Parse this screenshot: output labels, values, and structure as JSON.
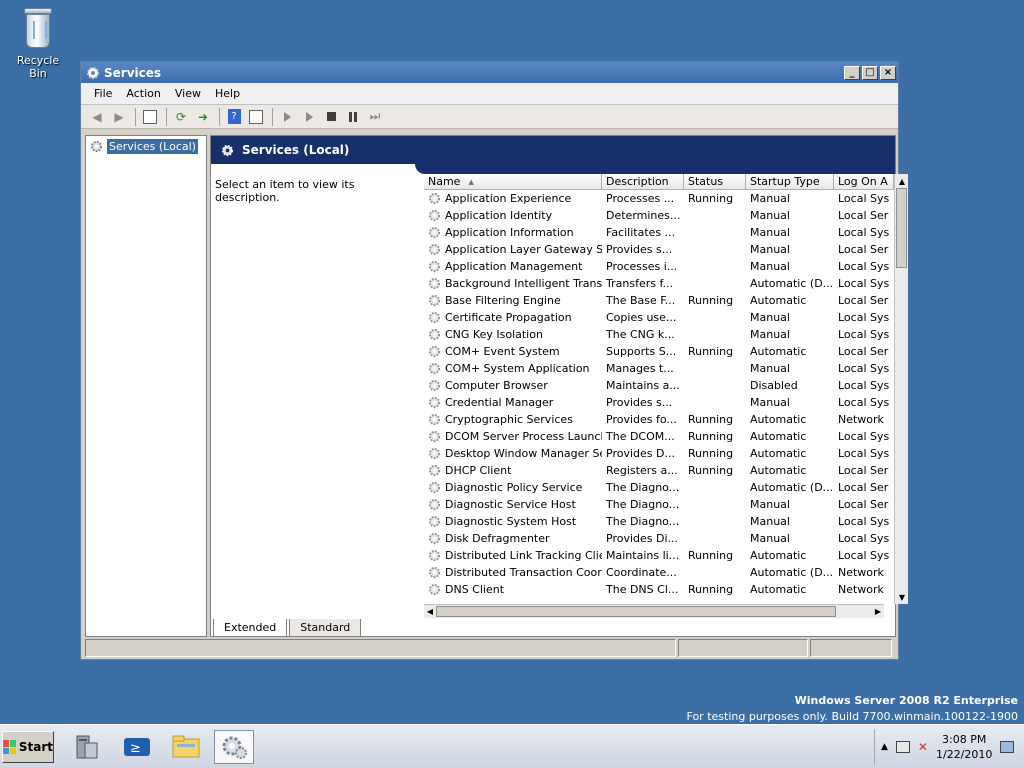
{
  "desktop": {
    "recycle_bin_label": "Recycle Bin"
  },
  "window": {
    "title": "Services",
    "controls": {
      "minimize": "_",
      "maximize": "□",
      "close": "×"
    }
  },
  "menu": [
    "File",
    "Action",
    "View",
    "Help"
  ],
  "tree": {
    "root": "Services (Local)"
  },
  "panel": {
    "header": "Services (Local)",
    "description_prompt": "Select an item to view its description."
  },
  "list": {
    "columns": [
      "Name",
      "Description",
      "Status",
      "Startup Type",
      "Log On A"
    ],
    "sort_indicator": "▲",
    "rows": [
      [
        "Application Experience",
        "Processes ...",
        "Running",
        "Manual",
        "Local Sys"
      ],
      [
        "Application Identity",
        "Determines...",
        "",
        "Manual",
        "Local Ser"
      ],
      [
        "Application Information",
        "Facilitates ...",
        "",
        "Manual",
        "Local Sys"
      ],
      [
        "Application Layer Gateway Se...",
        "Provides s...",
        "",
        "Manual",
        "Local Ser"
      ],
      [
        "Application Management",
        "Processes i...",
        "",
        "Manual",
        "Local Sys"
      ],
      [
        "Background Intelligent Transf...",
        "Transfers f...",
        "",
        "Automatic (D...",
        "Local Sys"
      ],
      [
        "Base Filtering Engine",
        "The Base F...",
        "Running",
        "Automatic",
        "Local Ser"
      ],
      [
        "Certificate Propagation",
        "Copies use...",
        "",
        "Manual",
        "Local Sys"
      ],
      [
        "CNG Key Isolation",
        "The CNG k...",
        "",
        "Manual",
        "Local Sys"
      ],
      [
        "COM+ Event System",
        "Supports S...",
        "Running",
        "Automatic",
        "Local Ser"
      ],
      [
        "COM+ System Application",
        "Manages t...",
        "",
        "Manual",
        "Local Sys"
      ],
      [
        "Computer Browser",
        "Maintains a...",
        "",
        "Disabled",
        "Local Sys"
      ],
      [
        "Credential Manager",
        "Provides s...",
        "",
        "Manual",
        "Local Sys"
      ],
      [
        "Cryptographic Services",
        "Provides fo...",
        "Running",
        "Automatic",
        "Network"
      ],
      [
        "DCOM Server Process Launcher",
        "The DCOM...",
        "Running",
        "Automatic",
        "Local Sys"
      ],
      [
        "Desktop Window Manager Se...",
        "Provides D...",
        "Running",
        "Automatic",
        "Local Sys"
      ],
      [
        "DHCP Client",
        "Registers a...",
        "Running",
        "Automatic",
        "Local Ser"
      ],
      [
        "Diagnostic Policy Service",
        "The Diagno...",
        "",
        "Automatic (D...",
        "Local Ser"
      ],
      [
        "Diagnostic Service Host",
        "The Diagno...",
        "",
        "Manual",
        "Local Ser"
      ],
      [
        "Diagnostic System Host",
        "The Diagno...",
        "",
        "Manual",
        "Local Sys"
      ],
      [
        "Disk Defragmenter",
        "Provides Di...",
        "",
        "Manual",
        "Local Sys"
      ],
      [
        "Distributed Link Tracking Client",
        "Maintains li...",
        "Running",
        "Automatic",
        "Local Sys"
      ],
      [
        "Distributed Transaction Coord...",
        "Coordinate...",
        "",
        "Automatic (D...",
        "Network"
      ],
      [
        "DNS Client",
        "The DNS Cl...",
        "Running",
        "Automatic",
        "Network"
      ]
    ]
  },
  "tabs": [
    "Extended",
    "Standard"
  ],
  "watermark": {
    "line1": "Windows Server 2008 R2 Enterprise",
    "line2": "For testing purposes only. Build 7700.winmain.100122-1900"
  },
  "taskbar": {
    "start_label": "Start",
    "time": "3:08 PM",
    "date": "1/22/2010"
  },
  "colors": {
    "desktop": "#3d6fa7",
    "header": "#17306b",
    "selection": "#3a6ea5"
  }
}
